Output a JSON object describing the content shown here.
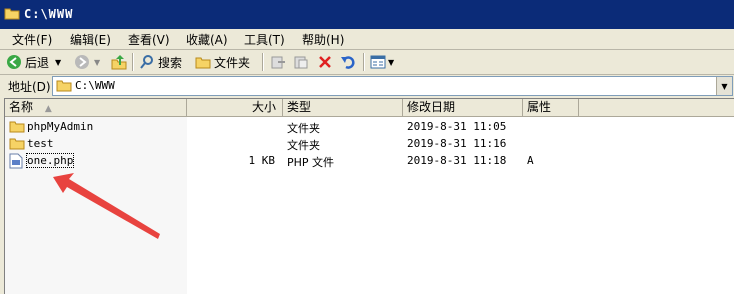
{
  "window": {
    "title": "C:\\WWW"
  },
  "menu": [
    {
      "label": "文件(F)"
    },
    {
      "label": "编辑(E)"
    },
    {
      "label": "查看(V)"
    },
    {
      "label": "收藏(A)"
    },
    {
      "label": "工具(T)"
    },
    {
      "label": "帮助(H)"
    }
  ],
  "toolbar": {
    "back_label": "后退",
    "search_label": "搜索",
    "folders_label": "文件夹"
  },
  "address": {
    "label": "地址(D)",
    "value": "C:\\WWW"
  },
  "columns": {
    "name": "名称",
    "size": "大小",
    "type": "类型",
    "modified": "修改日期",
    "attributes": "属性"
  },
  "files": [
    {
      "name": "phpMyAdmin",
      "size": "",
      "type": "文件夹",
      "modified": "2019-8-31 11:05",
      "attr": "",
      "icon": "folder-icon"
    },
    {
      "name": "test",
      "size": "",
      "type": "文件夹",
      "modified": "2019-8-31 11:16",
      "attr": "",
      "icon": "folder-icon"
    },
    {
      "name": "one.php",
      "size": "1 KB",
      "type": "PHP 文件",
      "modified": "2019-8-31 11:18",
      "attr": "A",
      "icon": "php-file-icon"
    }
  ],
  "colors": {
    "title_bg": "#0b2b78",
    "annotation_arrow": "#e8433f"
  }
}
